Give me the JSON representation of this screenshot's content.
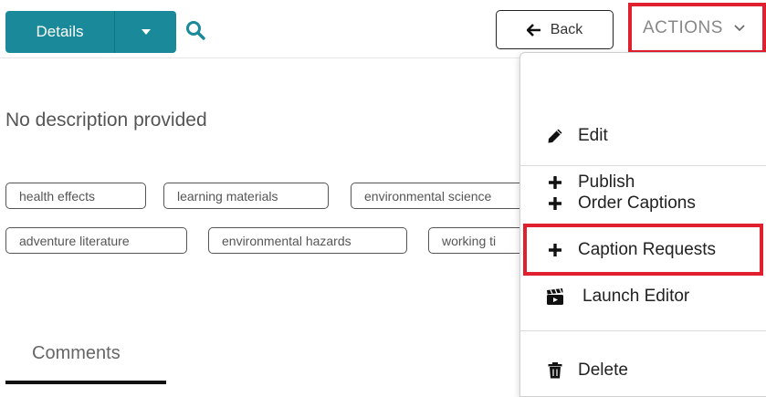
{
  "toolbar": {
    "details_label": "Details",
    "back_label": "Back",
    "actions_label": "ACTIONS"
  },
  "main": {
    "description": "No description provided",
    "tags": [
      "health effects",
      "learning materials",
      "environmental science",
      "adventure literature",
      "environmental hazards",
      "working ti"
    ],
    "comments_tab": "Comments"
  },
  "menu": {
    "items": [
      {
        "label": "Edit",
        "icon": "pencil-icon"
      },
      {
        "label": "Publish",
        "icon": "plus-icon"
      },
      {
        "label": "Order Captions",
        "icon": "plus-icon"
      },
      {
        "label": "Caption Requests",
        "icon": "plus-icon"
      },
      {
        "label": "Launch Editor",
        "icon": "clapperboard-icon"
      },
      {
        "label": "Delete",
        "icon": "trash-icon"
      }
    ]
  },
  "colors": {
    "primary": "#1a8a9a",
    "highlight": "#e0202f"
  }
}
